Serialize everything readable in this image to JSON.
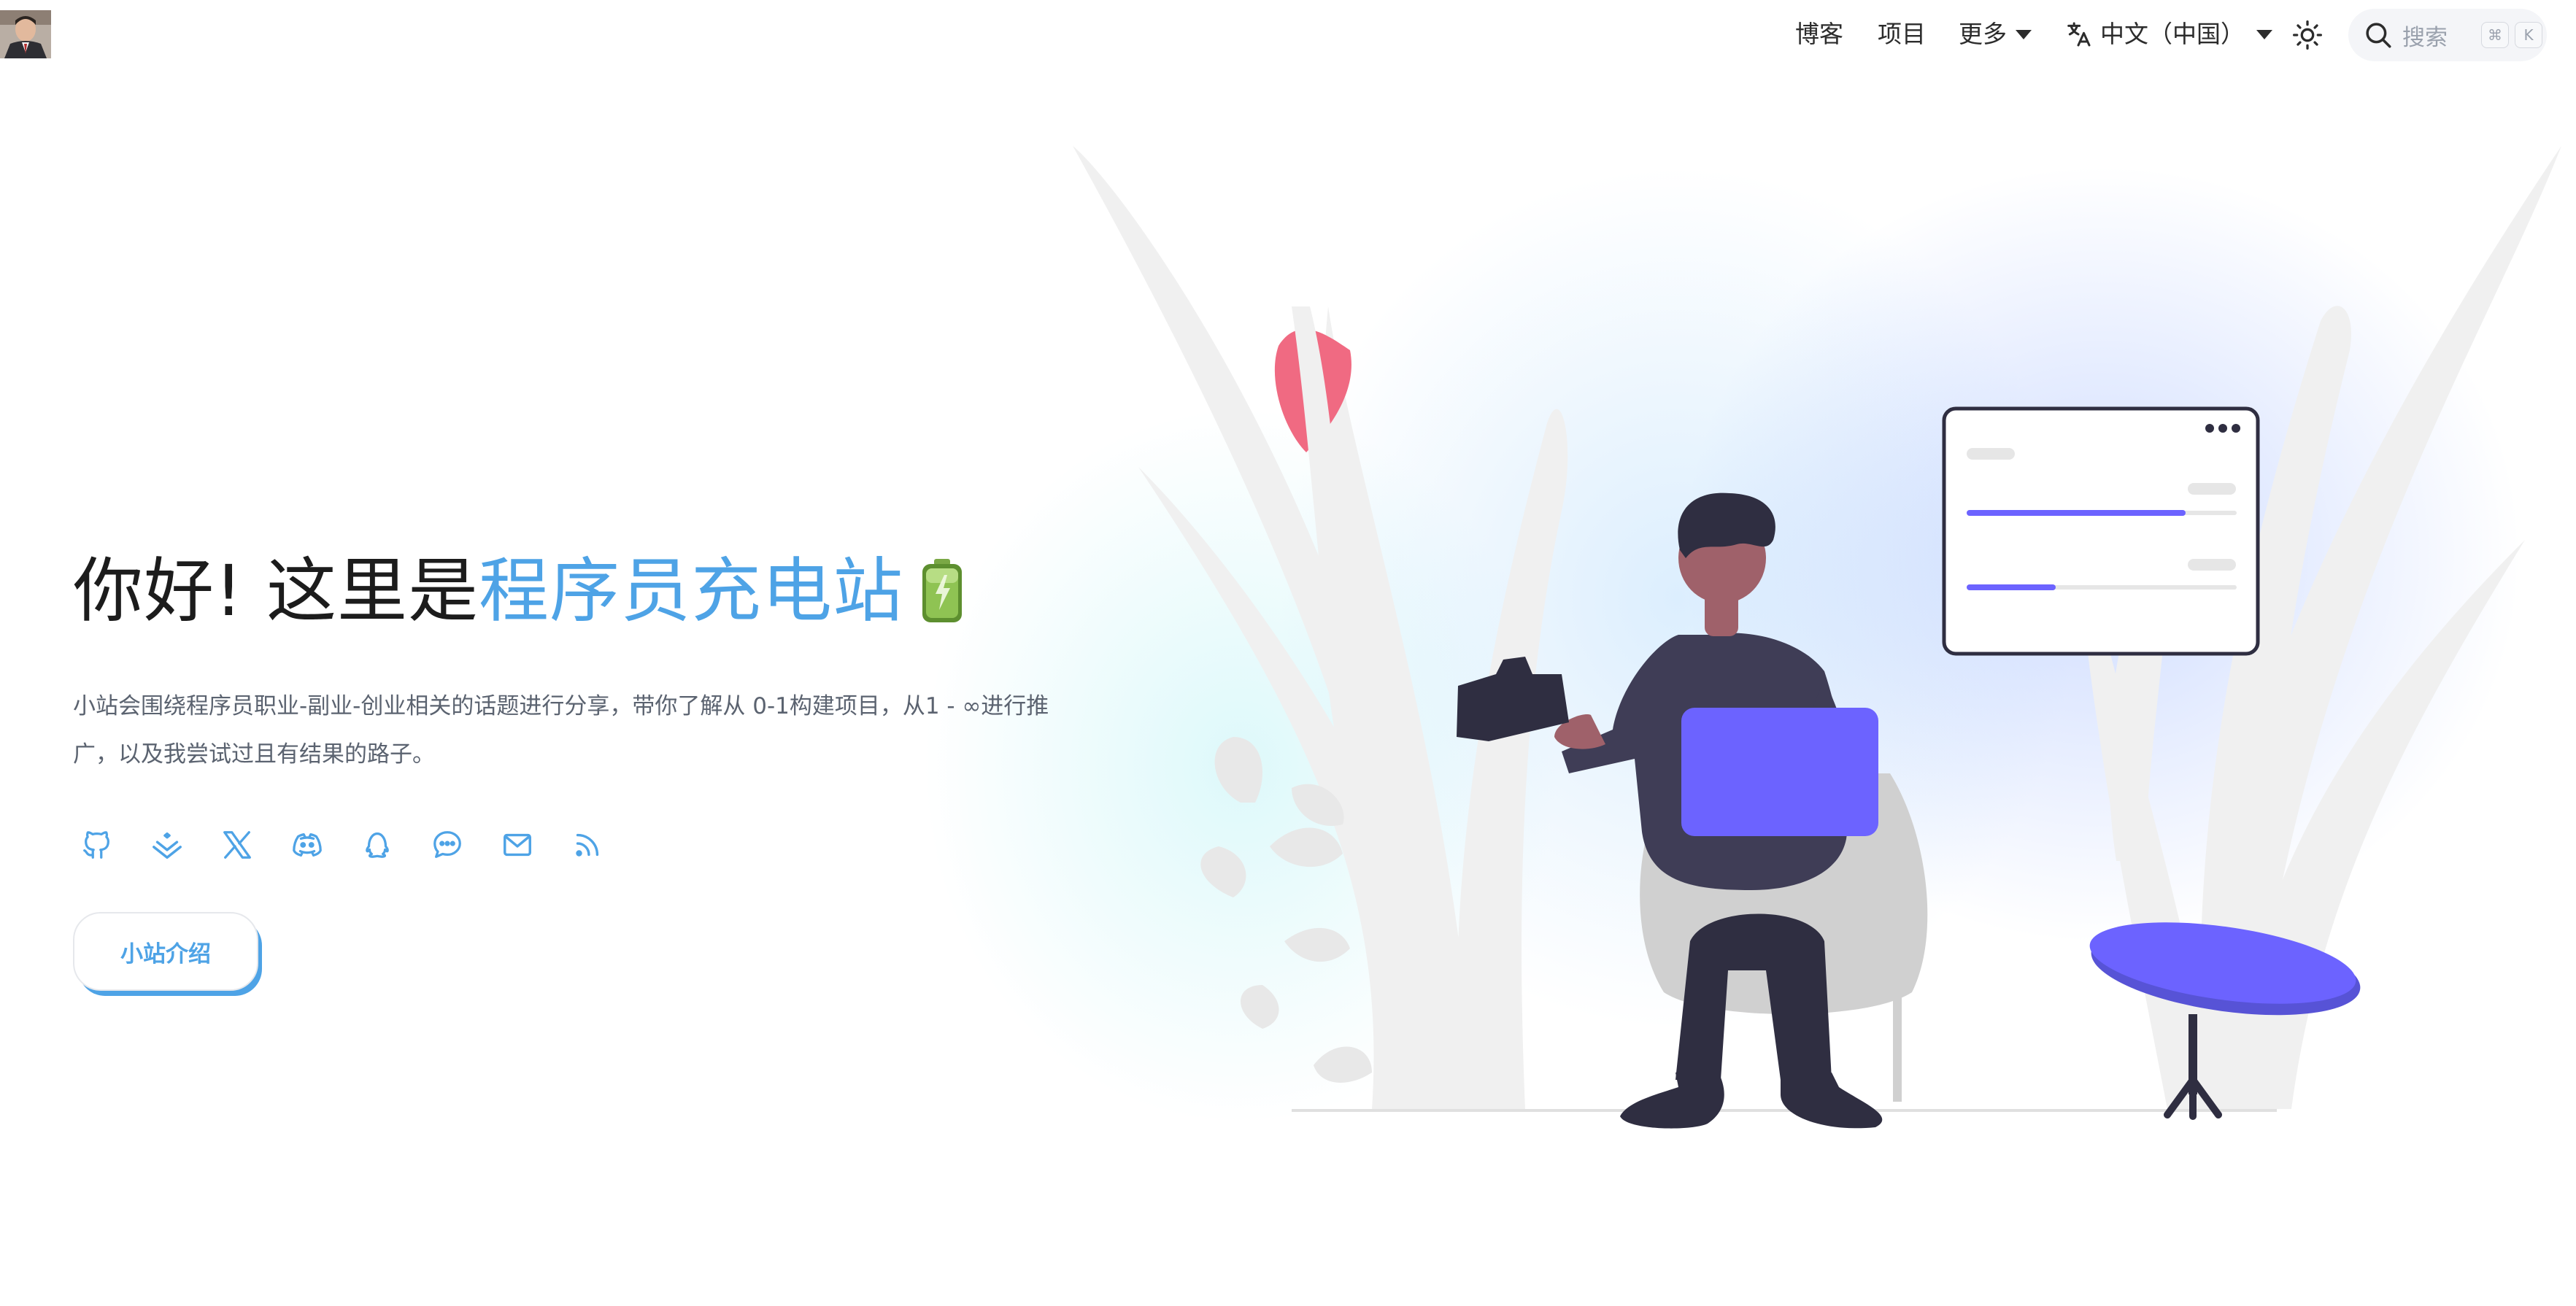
{
  "nav": {
    "blog": "博客",
    "projects": "项目",
    "more": "更多",
    "language": "中文（中国）",
    "search_label": "搜索",
    "search_key1": "⌘",
    "search_key2": "K"
  },
  "hero": {
    "title_prefix": "你好! 这里是",
    "title_brand": "程序员充电站",
    "description": "小站会围绕程序员职业-副业-创业相关的话题进行分享，带你了解从 0-1构建项目，从1 - ∞进行推广，以及我尝试过且有结果的路子。",
    "cta_label": "小站介绍"
  },
  "socials": [
    "github-icon",
    "juejin-icon",
    "x-icon",
    "discord-icon",
    "qq-icon",
    "wechat-icon",
    "mail-icon",
    "rss-icon"
  ],
  "colors": {
    "brand": "#4ea3e6",
    "accent_purple": "#6c63ff",
    "text": "#1c1c1c",
    "muted": "#5b6370"
  }
}
